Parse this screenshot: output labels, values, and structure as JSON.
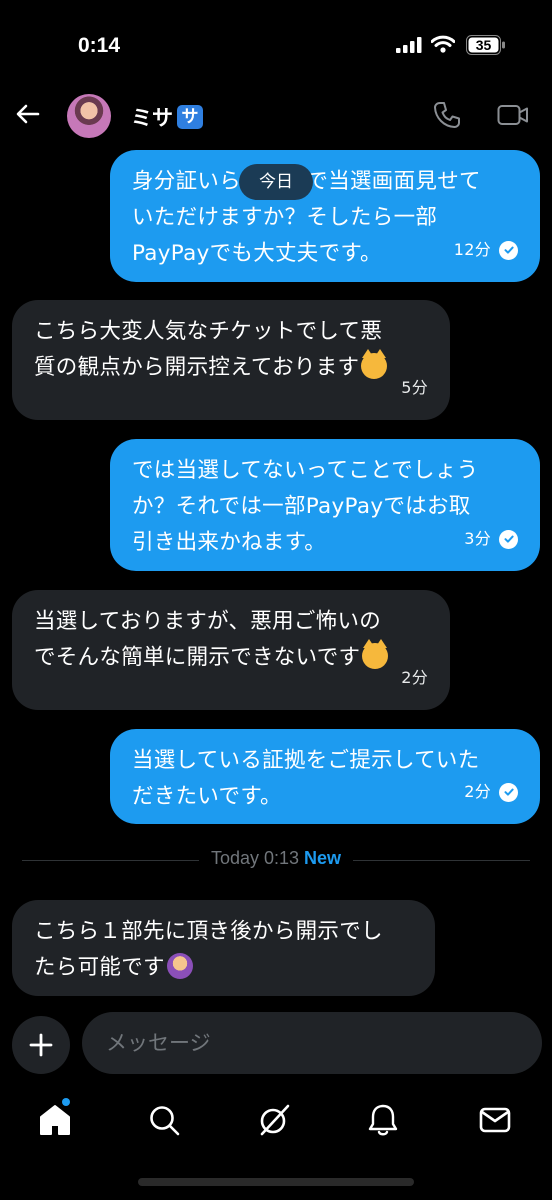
{
  "status_bar": {
    "time": "0:14",
    "battery": "35"
  },
  "header": {
    "contact_name": "ミサ",
    "name_badge": "サ"
  },
  "date_pill": "今日",
  "messages": [
    {
      "direction": "out",
      "text": "身分証いらないので当選画面見せて\nいただけますか？そしたら一部\nPayPayでも大丈夫です。",
      "time": "12分"
    },
    {
      "direction": "in",
      "text": "こちら大変人気なチケットでして悪\n質の観点から開示控えております",
      "emoji": "crying-cat-emoji",
      "time": "5分"
    },
    {
      "direction": "out",
      "text": "では当選してないってことでしょう\nか？それでは一部PayPayではお取\n引き出来かねます。",
      "time": "3分"
    },
    {
      "direction": "in",
      "text": "当選しておりますが、悪用ご怖いの\nでそんな簡単に開示できないです",
      "emoji": "crying-cat-emoji",
      "time": "2分"
    },
    {
      "direction": "out",
      "text": "当選している証拠をご提示していた\nだきたいです。",
      "time": "2分"
    },
    {
      "direction": "in",
      "text": "こちら１部先に頂き後から開示でし\nたら可能です",
      "emoji": "person-gesturing-ok-emoji"
    }
  ],
  "divider": {
    "time": "Today 0:13",
    "new_label": "New"
  },
  "composer": {
    "placeholder": "メッセージ"
  },
  "nav": {
    "items": [
      "home-icon",
      "search-icon",
      "grok-icon",
      "notifications-icon",
      "messages-icon"
    ]
  },
  "colors": {
    "accent": "#1d9bf0",
    "incoming_bubble": "#202327",
    "background": "#000000"
  }
}
